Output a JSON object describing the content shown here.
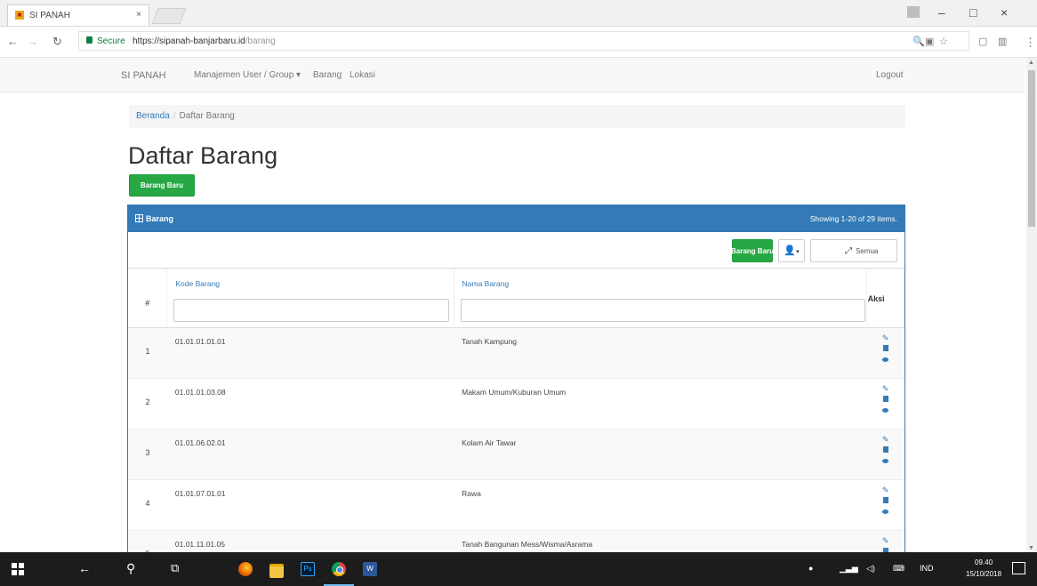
{
  "browser": {
    "tab_title": "SI PANAH",
    "tab_close": "×",
    "secure_label": "Secure",
    "url_host": "https://sipanah-banjarbaru.id",
    "url_path": "/barang",
    "window_min": "–",
    "window_max": "□",
    "window_close": "×"
  },
  "navbar": {
    "brand": "SI PANAH",
    "items": [
      "Manajemen User / Group ▾",
      "Barang",
      "Lokasi"
    ],
    "logout": "Logout"
  },
  "breadcrumb": {
    "home": "Beranda",
    "separator": "/",
    "current": "Daftar Barang"
  },
  "page": {
    "title": "Daftar Barang",
    "new_button": "Barang Baru"
  },
  "panel": {
    "title": "Barang",
    "summary": "Showing 1-20 of 29 items.",
    "new_button": "Barang Baru",
    "export_icon": "person-icon",
    "toggle_label": "Semua"
  },
  "table": {
    "hash": "#",
    "col_kode": "Kode Barang",
    "col_nama": "Nama Barang",
    "col_aksi": "Aksi",
    "rows": [
      {
        "no": "1",
        "kode": "01.01.01.01.01",
        "nama": "Tanah Kampung"
      },
      {
        "no": "2",
        "kode": "01.01.01.03.08",
        "nama": "Makam Umum/Kuburan Umum"
      },
      {
        "no": "3",
        "kode": "01.01.06.02.01",
        "nama": "Kolam Air Tawar"
      },
      {
        "no": "4",
        "kode": "01.01.07.01.01",
        "nama": "Rawa"
      },
      {
        "no": "5",
        "kode": "01.01.11.01.05",
        "nama": "Tanah Bangunan Mess/Wisma/Asrama"
      }
    ]
  },
  "taskbar": {
    "clock_time": "09.40",
    "clock_date": "15/10/2018",
    "language": "IND"
  },
  "colors": {
    "primary": "#337ab7",
    "success": "#28a745",
    "taskbar": "#1c1c1c"
  }
}
